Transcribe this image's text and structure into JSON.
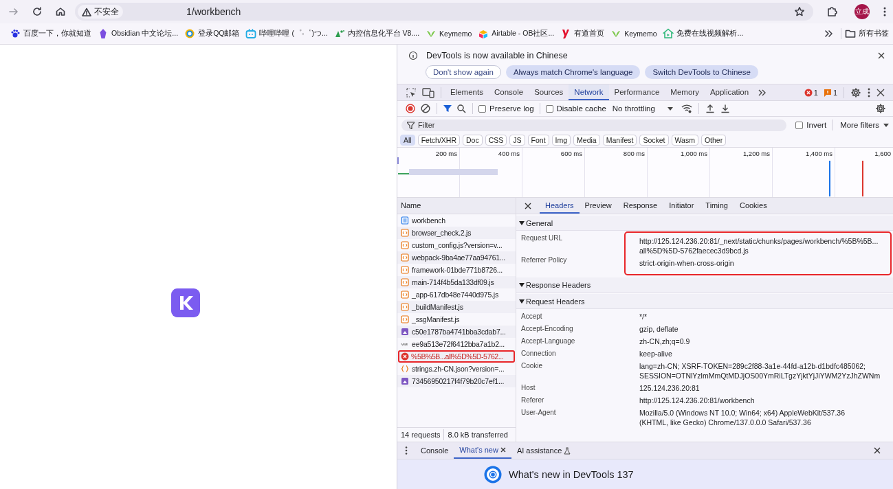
{
  "browser": {
    "security": "不安全",
    "url": "1/workbench",
    "avatar": "立成"
  },
  "bookmarks": [
    {
      "label": "百度一下，你就知道"
    },
    {
      "label": "Obsidian 中文论坛..."
    },
    {
      "label": "登录QQ邮箱"
    },
    {
      "label": "哔哩哔哩 (゜-゜)つ..."
    },
    {
      "label": "内控信息化平台 V8...."
    },
    {
      "label": "Keymemo"
    },
    {
      "label": "Airtable - OB社区..."
    },
    {
      "label": "有道首页"
    },
    {
      "label": "Keymemo"
    },
    {
      "label": "免费在线视频解析..."
    }
  ],
  "all_bookmarks": "所有书签",
  "devtools": {
    "infobar": {
      "message": "DevTools is now available in Chinese",
      "buttons": [
        {
          "label": "Don't show again",
          "kind": "outline"
        },
        {
          "label": "Always match Chrome's language",
          "kind": "filled"
        },
        {
          "label": "Switch DevTools to Chinese",
          "kind": "filled"
        }
      ]
    },
    "tabs": [
      {
        "label": "Elements",
        "selected": false
      },
      {
        "label": "Console",
        "selected": false
      },
      {
        "label": "Sources",
        "selected": false
      },
      {
        "label": "Network",
        "selected": true
      },
      {
        "label": "Performance",
        "selected": false
      },
      {
        "label": "Memory",
        "selected": false
      },
      {
        "label": "Application",
        "selected": false
      }
    ],
    "error_count": "1",
    "warning_count": "1",
    "toolbar": {
      "recording": true,
      "preserve_log": {
        "label": "Preserve log",
        "checked": false
      },
      "disable_cache": {
        "label": "Disable cache",
        "checked": false
      },
      "throttling": "No throttling"
    },
    "filter": {
      "placeholder": "Filter",
      "invert": {
        "label": "Invert",
        "checked": false
      },
      "more_filters": "More filters"
    },
    "type_filters": [
      {
        "label": "All",
        "selected": true
      },
      {
        "label": "Fetch/XHR",
        "selected": false
      },
      {
        "label": "Doc",
        "selected": false
      },
      {
        "label": "CSS",
        "selected": false
      },
      {
        "label": "JS",
        "selected": false
      },
      {
        "label": "Font",
        "selected": false
      },
      {
        "label": "Img",
        "selected": false
      },
      {
        "label": "Media",
        "selected": false
      },
      {
        "label": "Manifest",
        "selected": false
      },
      {
        "label": "Socket",
        "selected": false
      },
      {
        "label": "Wasm",
        "selected": false
      },
      {
        "label": "Other",
        "selected": false
      }
    ],
    "timeline_ticks": [
      "200 ms",
      "400 ms",
      "600 ms",
      "800 ms",
      "1,000 ms",
      "1,200 ms",
      "1,400 ms",
      "1,600"
    ],
    "name_header": "Name",
    "requests": [
      {
        "name": "workbench",
        "kind": "doc",
        "highlighted": false
      },
      {
        "name": "browser_check.2.js",
        "kind": "script",
        "highlighted": false
      },
      {
        "name": "custom_config.js?version=v...",
        "kind": "script",
        "highlighted": false
      },
      {
        "name": "webpack-9ba4ae77aa94761...",
        "kind": "script",
        "highlighted": false
      },
      {
        "name": "framework-01bde771b8726...",
        "kind": "script",
        "highlighted": false
      },
      {
        "name": "main-714f4b5da133df09.js",
        "kind": "script",
        "highlighted": false
      },
      {
        "name": "_app-617db48e7440d975.js",
        "kind": "script",
        "highlighted": false
      },
      {
        "name": "_buildManifest.js",
        "kind": "script",
        "highlighted": false
      },
      {
        "name": "_ssgManifest.js",
        "kind": "script",
        "highlighted": false
      },
      {
        "name": "c50e1787ba4741bba3cdab7...",
        "kind": "image",
        "highlighted": false
      },
      {
        "name": "ee9a513e72f6412bba7a1b2...",
        "kind": "other",
        "highlighted": false
      },
      {
        "name": "%5B%5B...all%5D%5D-5762...",
        "kind": "error",
        "highlighted": true
      },
      {
        "name": "strings.zh-CN.json?version=...",
        "kind": "json",
        "highlighted": false
      },
      {
        "name": "73456950217f4f79b20c7ef1...",
        "kind": "image",
        "highlighted": false
      }
    ],
    "summary": {
      "requests": "14 requests",
      "transferred": "8.0 kB transferred"
    },
    "detail_tabs": [
      {
        "label": "Headers",
        "selected": true
      },
      {
        "label": "Preview",
        "selected": false
      },
      {
        "label": "Response",
        "selected": false
      },
      {
        "label": "Initiator",
        "selected": false
      },
      {
        "label": "Timing",
        "selected": false
      },
      {
        "label": "Cookies",
        "selected": false
      }
    ],
    "sections": [
      {
        "title": "General",
        "expanded": true,
        "highlighted": true,
        "rows": [
          {
            "name": "Request URL",
            "value": [
              "http://125.124.236.20:81/_next/static/chunks/pages/workbench/%5B%5B...",
              "all%5D%5D-5762faecec3d9bcd.js"
            ]
          },
          {
            "name": "Referrer Policy",
            "value": [
              "strict-origin-when-cross-origin"
            ]
          }
        ]
      },
      {
        "title": "Response Headers",
        "expanded": true
      },
      {
        "title": "Request Headers",
        "expanded": true,
        "rows": [
          {
            "name": "Accept",
            "value": [
              "*/*"
            ]
          },
          {
            "name": "Accept-Encoding",
            "value": [
              "gzip, deflate"
            ]
          },
          {
            "name": "Accept-Language",
            "value": [
              "zh-CN,zh;q=0.9"
            ]
          },
          {
            "name": "Connection",
            "value": [
              "keep-alive"
            ]
          },
          {
            "name": "Cookie",
            "value": [
              "lang=zh-CN; XSRF-TOKEN=289c2f88-3a1e-44fd-a12b-d1bdfc485062;",
              "SESSION=OTNlYzlmMmQtMDJjOS00YmRiLTgzYjktYjJiYWM2YzJhZWNm"
            ]
          },
          {
            "name": "Host",
            "value": [
              "125.124.236.20:81"
            ]
          },
          {
            "name": "Referer",
            "value": [
              "http://125.124.236.20:81/workbench"
            ]
          },
          {
            "name": "User-Agent",
            "value": [
              "Mozilla/5.0 (Windows NT 10.0; Win64; x64) AppleWebKit/537.36",
              "(KHTML, like Gecko) Chrome/137.0.0.0 Safari/537.36"
            ]
          }
        ]
      }
    ],
    "drawer_tabs": [
      {
        "label": "Console",
        "selected": false,
        "closable": false
      },
      {
        "label": "What's new",
        "selected": true,
        "closable": true
      },
      {
        "label": "AI assistance",
        "selected": false,
        "closable": false
      }
    ],
    "whats_new_title": "What's new in DevTools 137"
  }
}
